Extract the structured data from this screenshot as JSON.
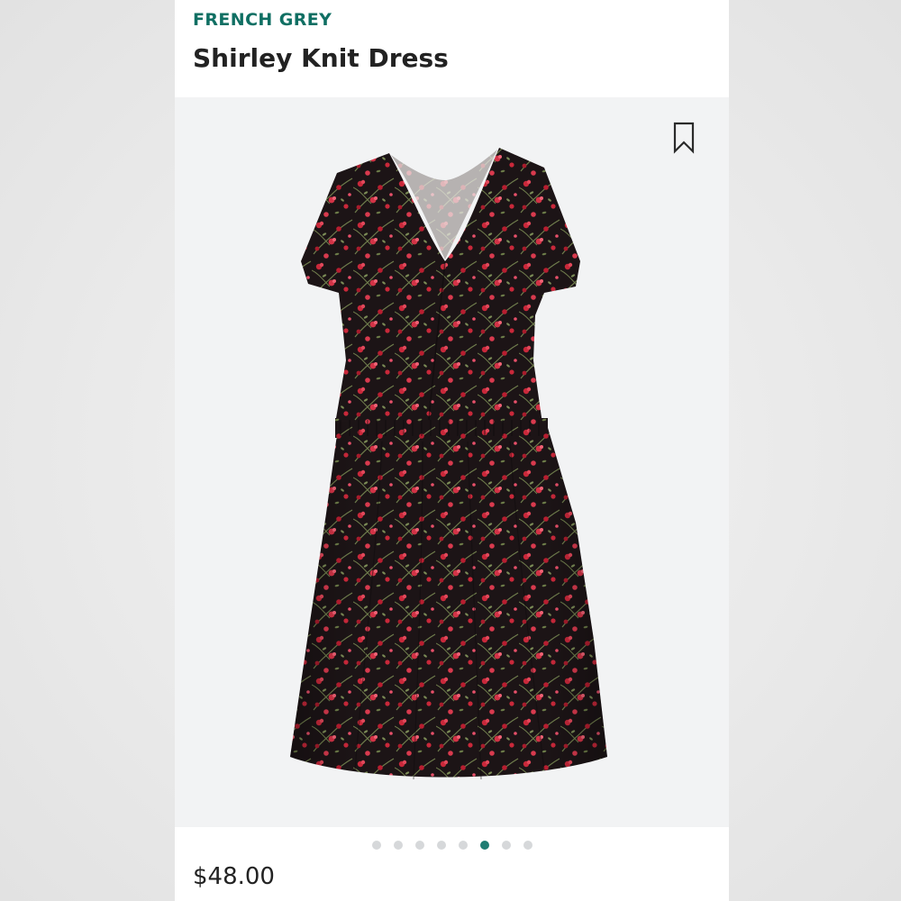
{
  "product": {
    "brand": "FRENCH GREY",
    "title": "Shirley Knit Dress",
    "price": "$48.00",
    "image_alt": "Black knit dress with small red floral print, short sleeves, V-neck and elastic waist"
  },
  "gallery": {
    "total_images": 8,
    "active_index": 5,
    "dots": [
      {
        "active": false
      },
      {
        "active": false
      },
      {
        "active": false
      },
      {
        "active": false
      },
      {
        "active": false
      },
      {
        "active": true
      },
      {
        "active": false
      },
      {
        "active": false
      }
    ]
  },
  "colors": {
    "brand_accent": "#0f6f63",
    "active_dot": "#1f7d73",
    "inactive_dot": "#d6d8da",
    "dress_base": "#1c1416",
    "print_red": "#c9283a",
    "print_green": "#7a8a55"
  },
  "icons": {
    "bookmark": "bookmark-icon"
  }
}
